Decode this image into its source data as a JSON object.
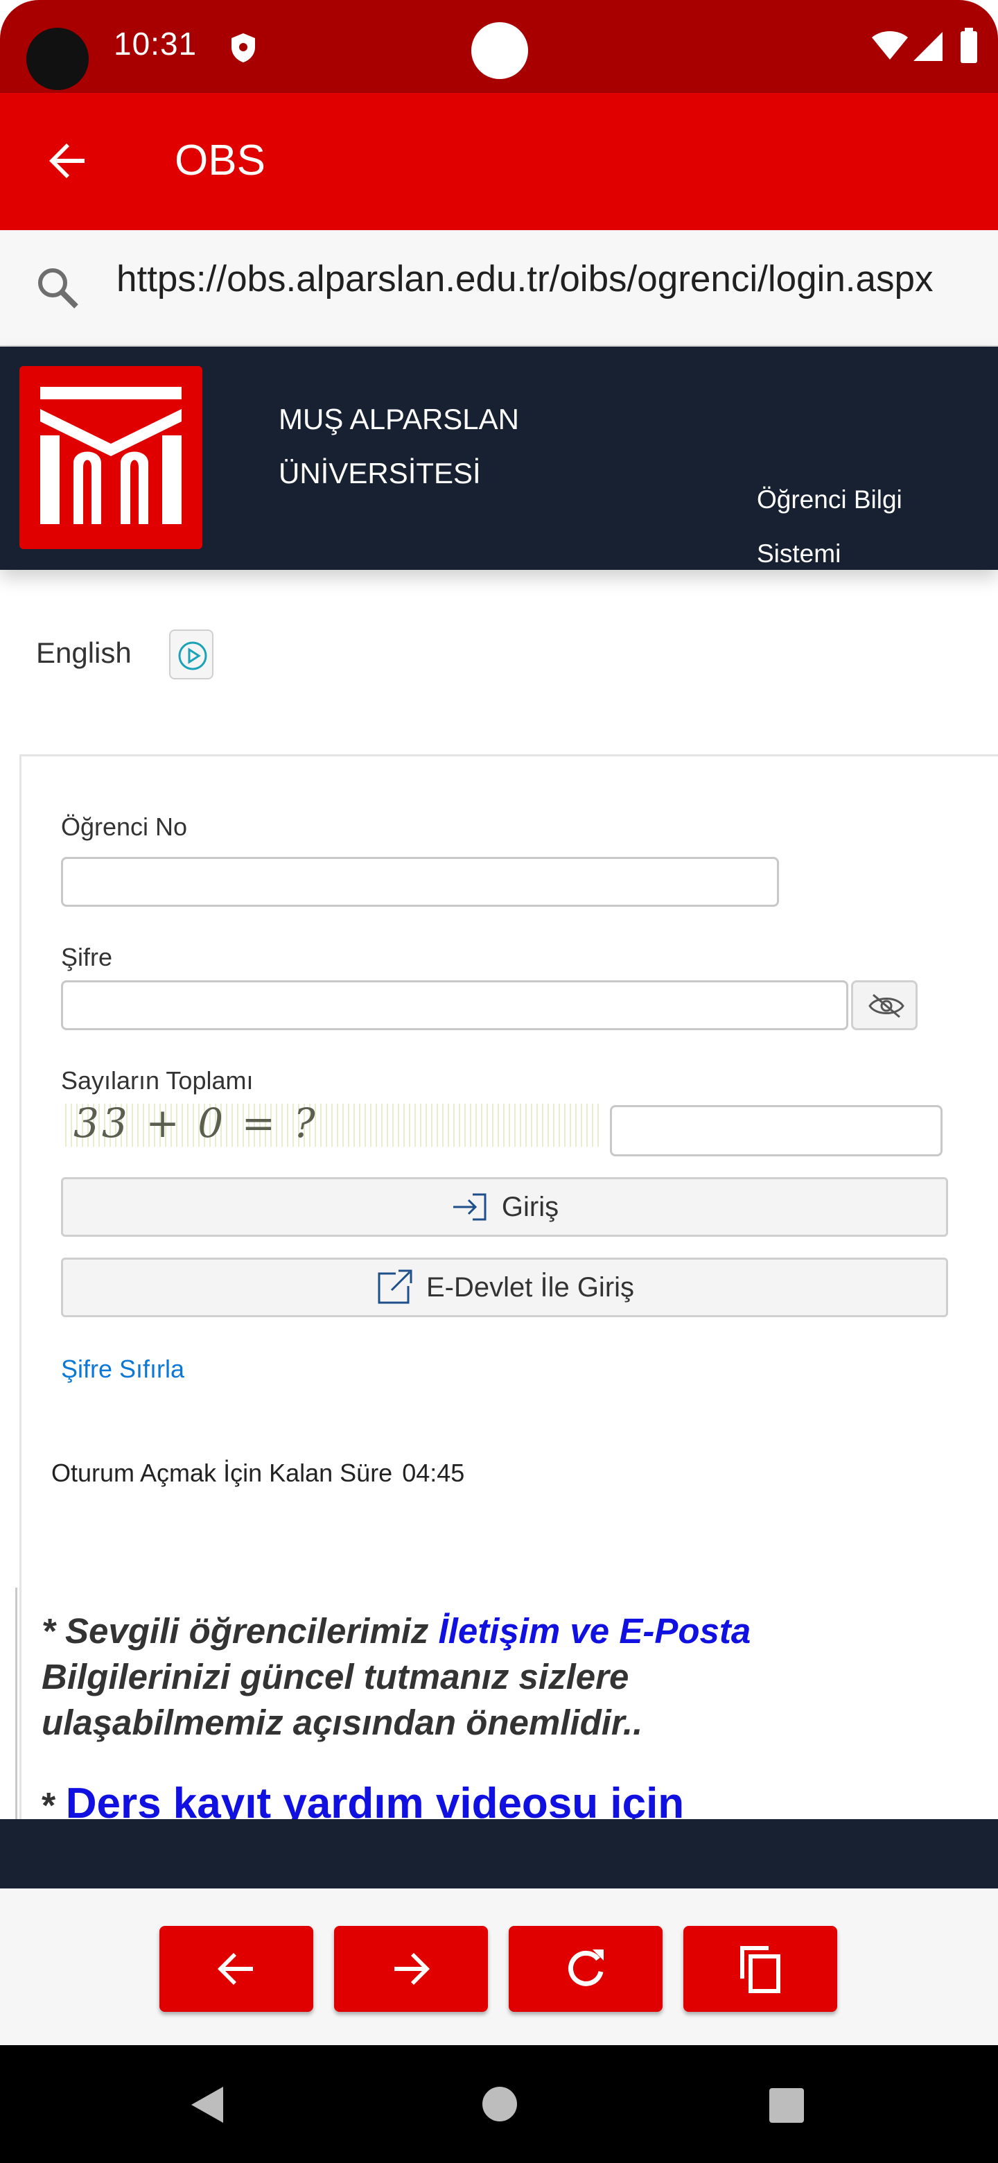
{
  "status_bar": {
    "time": "10:31"
  },
  "app_bar": {
    "title": "OBS"
  },
  "url_bar": {
    "url": "https://obs.alparslan.edu.tr/oibs/ogrenci/login.aspx"
  },
  "header": {
    "university_line1": "MUŞ ALPARSLAN",
    "university_line2": "ÜNİVERSİTESİ",
    "system_line1": "Öğrenci Bilgi",
    "system_line2": "Sistemi"
  },
  "language": {
    "label": "English"
  },
  "form": {
    "student_no_label": "Öğrenci No",
    "student_no_value": "",
    "password_label": "Şifre",
    "password_value": "",
    "captcha_label": "Sayıların Toplamı",
    "captcha_text": "33 + 0 = ?",
    "captcha_answer": "",
    "login_button": "Giriş",
    "edevlet_button": "E-Devlet İle Giriş",
    "reset_link": "Şifre Sıfırla",
    "timer_label": "Oturum Açmak İçin Kalan Süre",
    "timer_value": "04:45"
  },
  "notice": {
    "prefix": "* Sevgili öğrencilerimiz ",
    "highlight": "İletişim ve E-Posta",
    "suffix": " Bilgilerinizi güncel tutmanız sizlere ulaşabilmemiz açısından önemlidir..",
    "second_star": "* ",
    "second_link": "Ders kayıt yardım videosu için"
  },
  "colors": {
    "status_bar": "#a80000",
    "app_bar": "#e10000",
    "header_bg": "#172131",
    "link_blue": "#0b78d8",
    "notice_blue": "#1010e0"
  },
  "icons": {
    "app_back": "arrow-left-icon",
    "search": "search-icon",
    "eye_off": "eye-off-icon",
    "login": "sign-in-icon",
    "external": "external-link-icon",
    "nav_back": "arrow-left-icon",
    "nav_forward": "arrow-right-icon",
    "nav_reload": "reload-icon",
    "nav_copy": "copy-icon"
  }
}
